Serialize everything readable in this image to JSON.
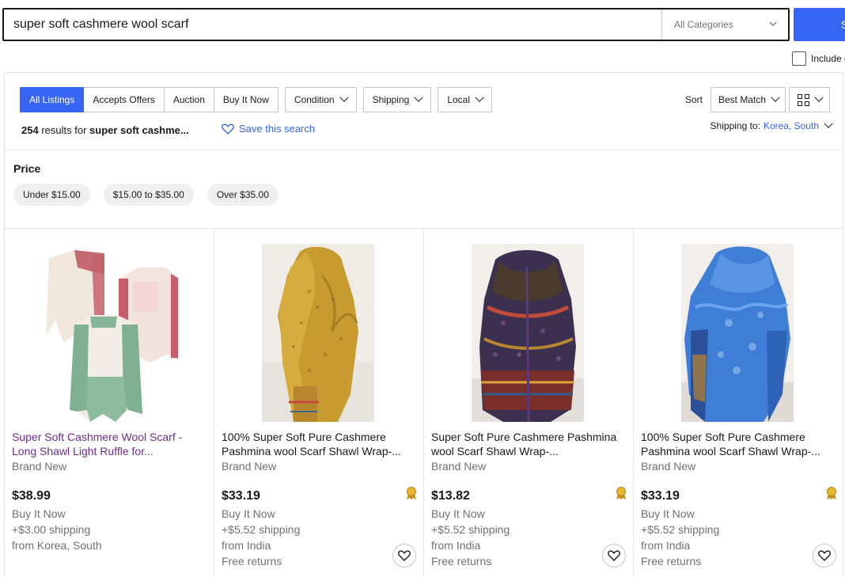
{
  "search": {
    "query": "super soft cashmere wool scarf",
    "category": "All Categories",
    "button_label": "S",
    "include_label": "Include d"
  },
  "filters": {
    "tabs": [
      "All Listings",
      "Accepts Offers",
      "Auction",
      "Buy It Now"
    ],
    "dropdowns": [
      "Condition",
      "Shipping",
      "Local"
    ]
  },
  "sort": {
    "label": "Sort",
    "value": "Best Match"
  },
  "results": {
    "count": "254",
    "text": "results for",
    "query_short": "super soft cashme..."
  },
  "save_search": "Save this search",
  "shipping_to": {
    "label": "Shipping to:",
    "value": "Korea, South"
  },
  "price_filter": {
    "title": "Price",
    "options": [
      "Under $15.00",
      "$15.00 to $35.00",
      "Over $35.00"
    ]
  },
  "listings": [
    {
      "title": "Super Soft Cashmere Wool Scarf - Long Shawl Light Ruffle for...",
      "condition": "Brand New",
      "price": "$38.99",
      "format": "Buy It Now",
      "shipping": "+$3.00 shipping",
      "location": "from Korea, South",
      "returns": "",
      "visited": true,
      "top_rated": false
    },
    {
      "title": "100% Super Soft Pure Cashmere Pashmina wool Scarf Shawl Wrap-...",
      "condition": "Brand New",
      "price": "$33.19",
      "format": "Buy It Now",
      "shipping": "+$5.52 shipping",
      "location": "from India",
      "returns": "Free returns",
      "visited": false,
      "top_rated": true
    },
    {
      "title": "Super Soft Pure Cashmere Pashmina wool Scarf Shawl Wrap-...",
      "condition": "Brand New",
      "price": "$13.82",
      "format": "Buy It Now",
      "shipping": "+$5.52 shipping",
      "location": "from India",
      "returns": "Free returns",
      "visited": false,
      "top_rated": true
    },
    {
      "title": "100% Super Soft Pure Cashmere Pashmina wool Scarf Shawl Wrap-...",
      "condition": "Brand New",
      "price": "$33.19",
      "format": "Buy It Now",
      "shipping": "+$5.52 shipping",
      "location": "from India",
      "returns": "Free returns",
      "visited": false,
      "top_rated": true
    }
  ],
  "colors": {
    "accent": "#3665f3",
    "visited": "#6e2b8f",
    "muted": "#707070"
  }
}
